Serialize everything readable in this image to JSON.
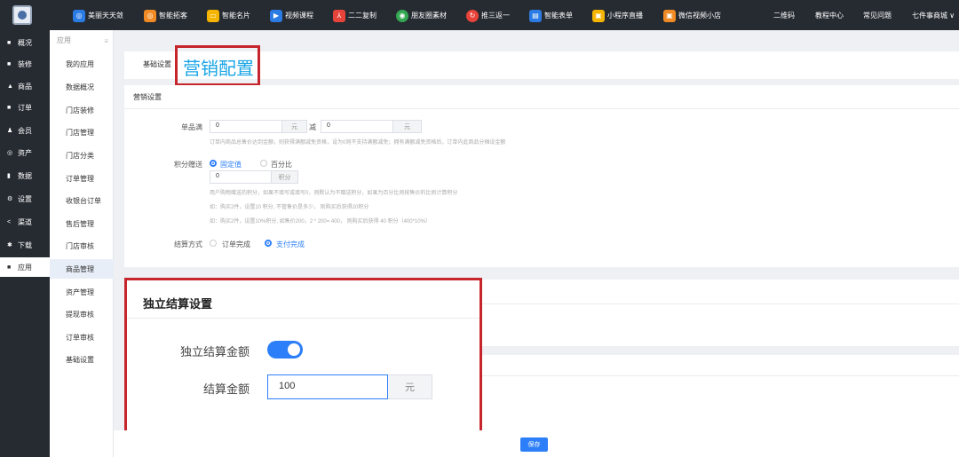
{
  "topnav": {
    "items": [
      {
        "label": "美丽天天敛",
        "color": "#2a7be4",
        "icon": "tag-icon"
      },
      {
        "label": "智能拓客",
        "color": "#f08a24",
        "icon": "target-icon"
      },
      {
        "label": "智能名片",
        "color": "#f4b400",
        "icon": "card-icon"
      },
      {
        "label": "视频课程",
        "color": "#2a7be4",
        "icon": "video-icon"
      },
      {
        "label": "二二复制",
        "color": "#e8433a",
        "icon": "share-icon"
      },
      {
        "label": "朋友圈素材",
        "color": "#34a853",
        "icon": "moments-icon"
      },
      {
        "label": "推三返一",
        "color": "#e8433a",
        "icon": "return-icon"
      },
      {
        "label": "智能表单",
        "color": "#2a7be4",
        "icon": "form-icon"
      },
      {
        "label": "小程序直播",
        "color": "#f4b400",
        "icon": "live-icon"
      },
      {
        "label": "微信视频小店",
        "color": "#f08a24",
        "icon": "store-icon"
      }
    ],
    "right": [
      "二维码",
      "教程中心",
      "常见问题",
      "七件事商城 ∨"
    ]
  },
  "sidebar": {
    "items": [
      {
        "label": "概况",
        "icon": "■"
      },
      {
        "label": "装修",
        "icon": "■"
      },
      {
        "label": "商品",
        "icon": "▲"
      },
      {
        "label": "订单",
        "icon": "■"
      },
      {
        "label": "会员",
        "icon": "♟"
      },
      {
        "label": "资产",
        "icon": "◎"
      },
      {
        "label": "数据",
        "icon": "▮"
      },
      {
        "label": "设置",
        "icon": "⚙"
      },
      {
        "label": "渠道",
        "icon": "<"
      },
      {
        "label": "下载",
        "icon": "✱"
      },
      {
        "label": "应用",
        "icon": "■"
      }
    ]
  },
  "subnav": {
    "header": "应用",
    "items": [
      "我的应用",
      "数据概况",
      "门店装修",
      "门店管理",
      "门店分类",
      "订单管理",
      "收银台订单",
      "售后管理",
      "门店审核",
      "商品管理",
      "资产管理",
      "提现审核",
      "订单审核",
      "基础设置"
    ]
  },
  "tabs": {
    "basic": "基础设置",
    "marketing": "营销配置"
  },
  "marketing": {
    "section_title": "营销设置",
    "single_full_label": "单品满",
    "single_full_value": "0",
    "unit_yuan": "元",
    "minus_label": "减",
    "minus_value": "0",
    "single_full_hint": "订单内商品总售价达到金额，则获得满额减免资格，设为0则不支持满额减免；拥有满额减免资格后，订单内此商品分摊设金额",
    "points_label": "积分赠送",
    "points_fixed": "固定值",
    "points_percent": "百分比",
    "points_value": "0",
    "points_unit": "积分",
    "points_hint1": "用户购物赠送的积分，如果不填写或填写0，则默认为不赠送积分，如果为百分比则按售价的比例计算积分",
    "points_hint2": "如：购买2件，设置10 积分, 不管售价是多少， 则购买后获得20积分",
    "points_hint3": "如：购买2件，设置10%积分, 如售价200，2 * 200= 400， 则购买后获得 40 积分（400*10%）",
    "settle_label": "结算方式",
    "settle_opt1": "订单完成",
    "settle_opt2": "支付完成"
  },
  "independent": {
    "title": "独立结算设置",
    "toggle_label": "独立结算金额",
    "toggle_on": true,
    "amount_label": "结算金额",
    "amount_value": "100",
    "amount_unit": "元"
  },
  "save_label": "保存",
  "colors": {
    "accent": "#2d7ff9",
    "callout": "#c6252c",
    "nav_bg": "#262b32"
  }
}
